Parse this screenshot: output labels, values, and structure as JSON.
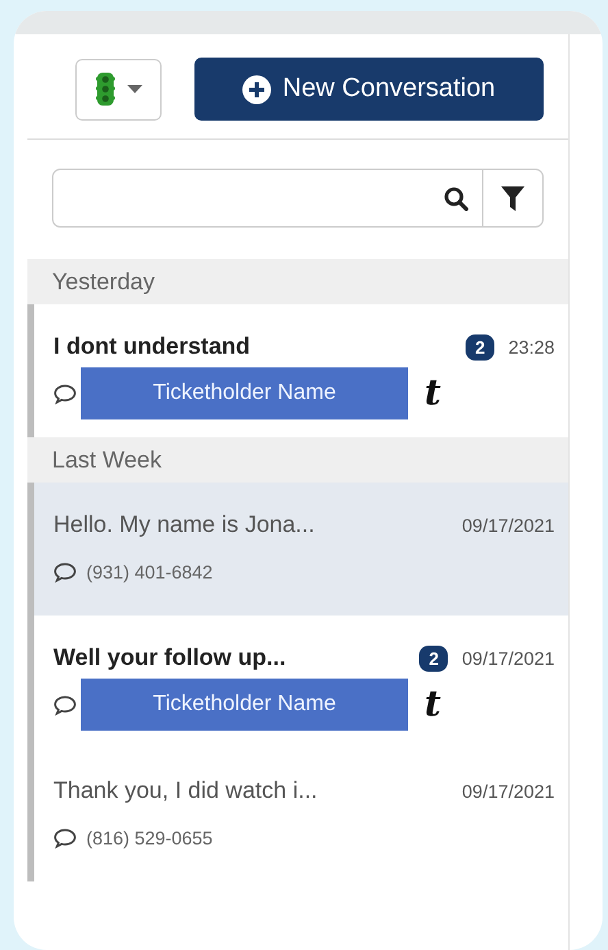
{
  "toolbar": {
    "new_button": {
      "label": "New Conversation"
    }
  },
  "groups": [
    {
      "label": "Yesterday",
      "items": [
        {
          "title": "I dont understand",
          "unread": true,
          "selected": false,
          "badge": "2",
          "time": "23:28",
          "kind": "redacted",
          "redaction": "Ticketholder Name",
          "suffix": "t"
        }
      ]
    },
    {
      "label": "Last Week",
      "items": [
        {
          "title": "Hello. My name is Jona...",
          "unread": false,
          "selected": true,
          "time": "09/17/2021",
          "kind": "phone",
          "phone": "(931) 401-6842"
        },
        {
          "title": "Well your follow up...",
          "unread": true,
          "selected": false,
          "badge": "2",
          "time": "09/17/2021",
          "kind": "redacted",
          "redaction": "Ticketholder Name",
          "suffix": "t"
        },
        {
          "title": "Thank you, I did watch i...",
          "unread": false,
          "selected": false,
          "time": "09/17/2021",
          "kind": "phone",
          "phone": "(816) 529-0655"
        }
      ]
    }
  ]
}
